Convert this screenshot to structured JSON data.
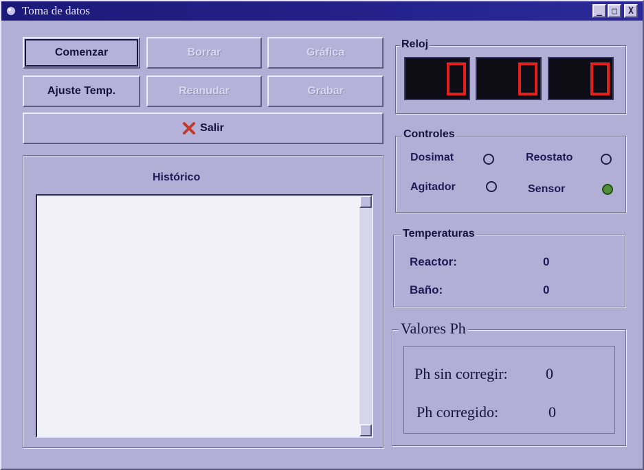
{
  "window": {
    "title": "Toma de datos",
    "controls": {
      "minimize": "_",
      "maximize": "□",
      "close": "X"
    }
  },
  "buttons": {
    "comenzar": "Comenzar",
    "borrar": "Borrar",
    "grafica": "Gráfica",
    "ajuste_temp": "Ajuste Temp.",
    "reanudar": "Reanudar",
    "grabar": "Grabar",
    "salir": "Salir"
  },
  "historico": {
    "title": "Histórico",
    "text": ""
  },
  "reloj": {
    "label": "Reloj",
    "digits": [
      "0",
      "0",
      "0"
    ]
  },
  "controles": {
    "label": "Controles",
    "items": [
      {
        "label": "Dosimat",
        "state": false
      },
      {
        "label": "Reostato",
        "state": false
      },
      {
        "label": "Agitador",
        "state": false
      },
      {
        "label": "Sensor",
        "state": true
      }
    ]
  },
  "temperaturas": {
    "label": "Temperaturas",
    "reactor_label": "Reactor:",
    "reactor_value": "0",
    "bano_label": "Baño:",
    "bano_value": "0"
  },
  "ph": {
    "label": "Valores Ph",
    "sin_corregir_label": "Ph sin corregir:",
    "sin_corregir_value": "0",
    "corregido_label": "Ph corregido:",
    "corregido_value": "0"
  },
  "colors": {
    "titlebar": "#1b1978",
    "face": "#b1afd6",
    "segment": "#e2201c",
    "led_on": "#4f8f35"
  }
}
